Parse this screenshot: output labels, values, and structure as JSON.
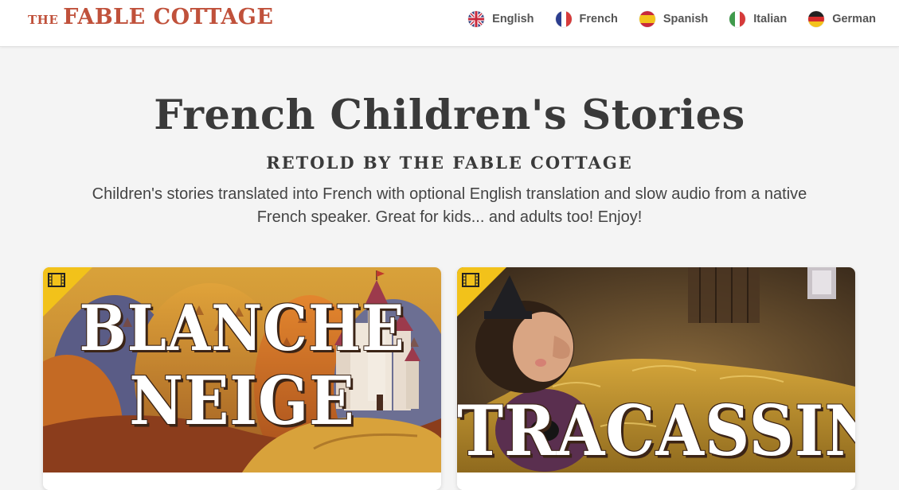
{
  "header": {
    "logo_prefix": "THE",
    "logo_main": "FABLE COTTAGE",
    "brand_color": "#c0513b",
    "languages": [
      {
        "label": "English",
        "icon": "uk-flag-icon"
      },
      {
        "label": "French",
        "icon": "france-flag-icon"
      },
      {
        "label": "Spanish",
        "icon": "spain-flag-icon"
      },
      {
        "label": "Italian",
        "icon": "italy-flag-icon"
      },
      {
        "label": "German",
        "icon": "germany-flag-icon"
      }
    ]
  },
  "hero": {
    "title": "French Children's Stories",
    "subtitle": "RETOLD BY THE FABLE COTTAGE",
    "description": "Children's stories translated into French with optional English translation and slow audio from a native French speaker. Great for kids... and adults too! Enjoy!"
  },
  "stories": [
    {
      "title_line1": "BLANCHE",
      "title_line2": "NEIGE",
      "badge_icon": "film-icon",
      "badge_color": "#f2c21a"
    },
    {
      "title_line1": "TRACASSIN",
      "badge_icon": "film-icon",
      "badge_color": "#f2c21a"
    }
  ]
}
